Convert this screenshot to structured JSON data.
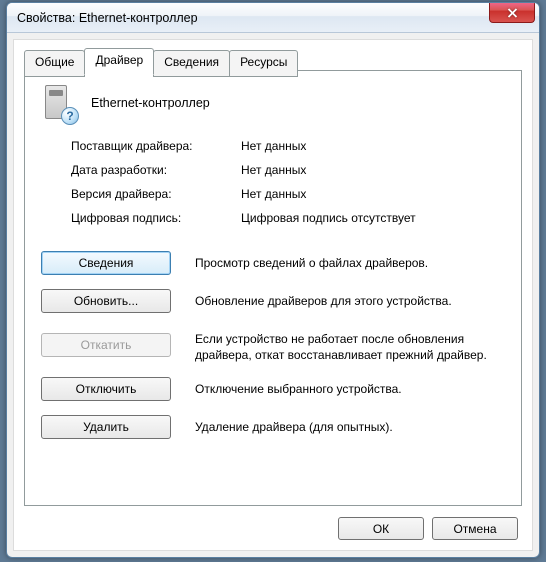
{
  "window": {
    "title": "Свойства: Ethernet-контроллер"
  },
  "tabs": {
    "general": "Общие",
    "driver": "Драйвер",
    "details": "Сведения",
    "resources": "Ресурсы",
    "active": "driver"
  },
  "device": {
    "name": "Ethernet-контроллер",
    "icon": "device-unknown-icon"
  },
  "properties": [
    {
      "label": "Поставщик драйвера:",
      "value": "Нет данных"
    },
    {
      "label": "Дата разработки:",
      "value": "Нет данных"
    },
    {
      "label": "Версия драйвера:",
      "value": "Нет данных"
    },
    {
      "label": "Цифровая подпись:",
      "value": "Цифровая подпись отсутствует"
    }
  ],
  "actions": {
    "details": {
      "label": "Сведения",
      "desc": "Просмотр сведений о файлах драйверов."
    },
    "update": {
      "label": "Обновить...",
      "desc": "Обновление драйверов для этого устройства."
    },
    "rollback": {
      "label": "Откатить",
      "desc": "Если устройство не работает после обновления драйвера, откат восстанавливает прежний драйвер.",
      "enabled": false
    },
    "disable": {
      "label": "Отключить",
      "desc": "Отключение выбранного устройства."
    },
    "delete": {
      "label": "Удалить",
      "desc": "Удаление драйвера (для опытных)."
    }
  },
  "dialog_buttons": {
    "ok": "ОК",
    "cancel": "Отмена"
  }
}
